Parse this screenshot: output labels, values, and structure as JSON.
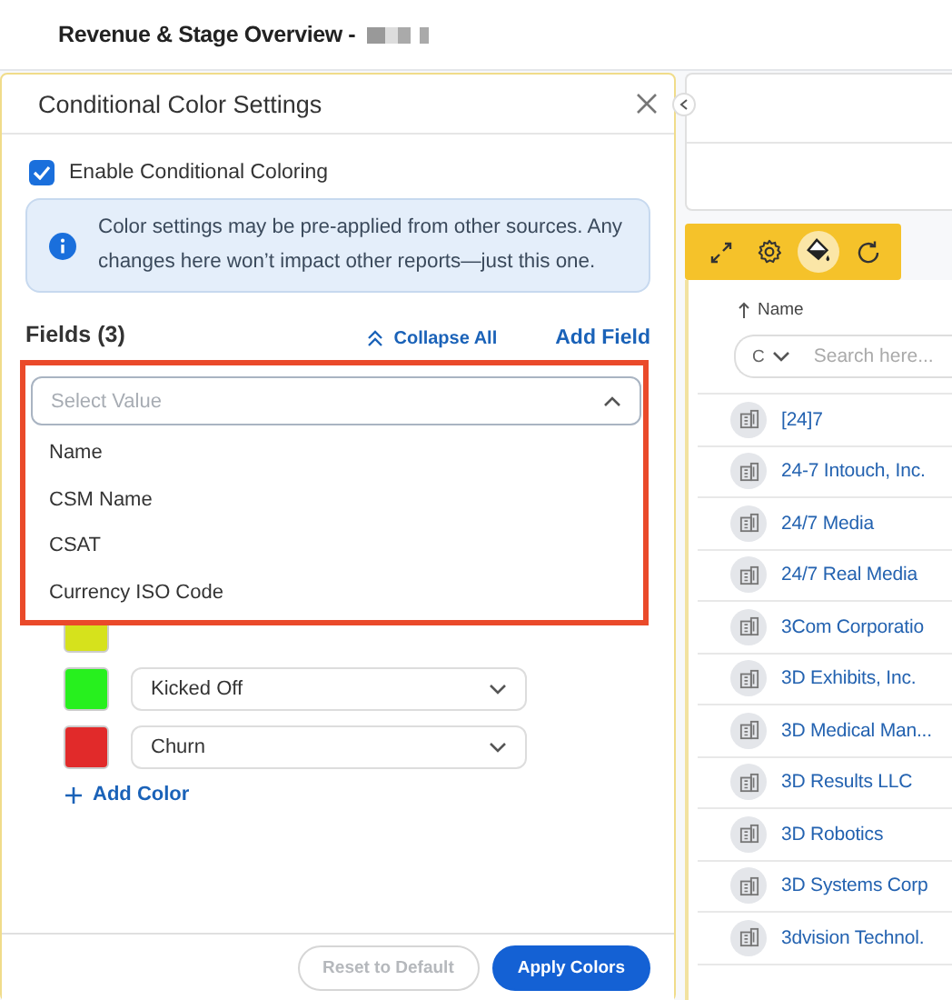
{
  "page_title": "Revenue & Stage Overview -",
  "panel": {
    "title": "Conditional Color Settings",
    "enable": {
      "label": "Enable Conditional Coloring",
      "checked": true
    },
    "info": "Color settings may be pre-applied from other sources. Any changes here won’t impact other reports—just this one.",
    "fields_heading": "Fields (3)",
    "collapse_all": "Collapse All",
    "add_field": "Add Field",
    "dropdown": {
      "placeholder": "Select Value",
      "options": [
        "Name",
        "CSM Name",
        "CSAT",
        "Currency ISO Code"
      ]
    },
    "colors": [
      {
        "color": "#d6e21c"
      },
      {
        "color": "#27f01e",
        "value": "Kicked Off"
      },
      {
        "color": "#e12a2a",
        "value": "Churn"
      }
    ],
    "add_color": "Add Color",
    "buttons": [
      {
        "label": "Reset to Default",
        "disabled": true
      },
      {
        "label": "Apply Colors",
        "disabled": false
      }
    ]
  },
  "table": {
    "sort_column": "Name",
    "filter_value": "C",
    "search_placeholder": "Search here...",
    "rows": [
      "[24]7",
      "24-7 Intouch, Inc.",
      "24/7 Media",
      "24/7 Real Media",
      "3Com Corporatio",
      "3D Exhibits, Inc.",
      "3D Medical Man...",
      "3D Results LLC",
      "3D Robotics",
      "3D Systems Corp",
      "3dvision Technol."
    ]
  }
}
